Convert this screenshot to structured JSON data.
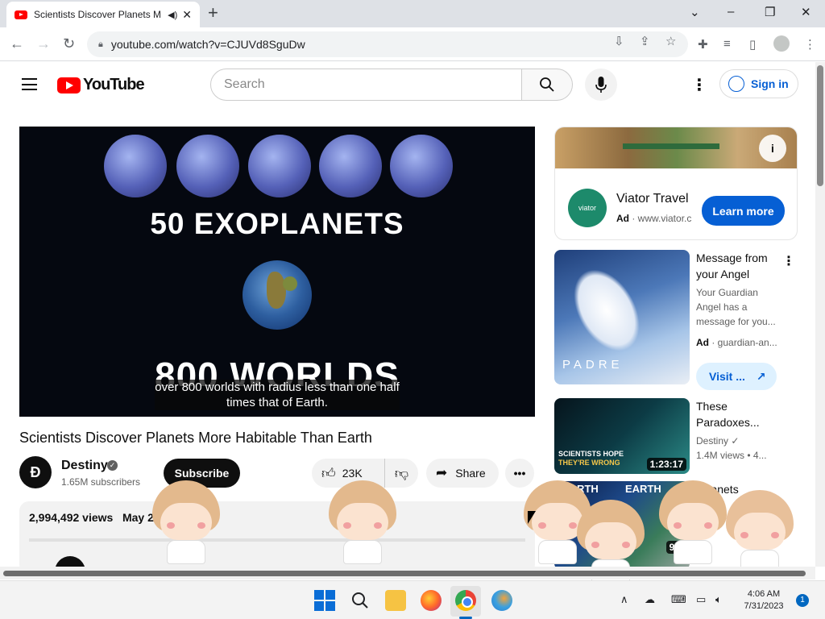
{
  "browser": {
    "tab_title": "Scientists Discover Planets M",
    "audio_icon": "speaker-icon",
    "url": "youtube.com/watch?v=CJUVd8SguDw",
    "new_tab": "+",
    "controls": {
      "dropdown": "⌄",
      "minimize": "–",
      "restore": "❐",
      "close": "✕"
    }
  },
  "youtube": {
    "logo_text": "YouTube",
    "search_placeholder": "Search",
    "sign_in": "Sign in"
  },
  "player": {
    "overlay_title_top": "50 EXOPLANETS",
    "overlay_title_bottom": "800 WORLDS",
    "caption": "over 800 worlds with radius less than one half times that of Earth."
  },
  "video": {
    "title": "Scientists Discover Planets More Habitable Than Earth",
    "channel": "Destiny",
    "subscribers": "1.65M subscribers",
    "subscribe_label": "Subscribe",
    "likes": "23K",
    "share_label": "Share",
    "views": "2,994,492 views",
    "date": "May 2"
  },
  "sidebar": {
    "ad": {
      "title": "Viator Travel",
      "badge": "Ad",
      "domain": "www.viator.c",
      "cta": "Learn more",
      "logo_text": "viator"
    },
    "recommendations": [
      {
        "title": "Message from your Angel",
        "desc": "Your Guardian Angel has a message for you...",
        "badge": "Ad",
        "domain": "guardian-an...",
        "cta": "Visit ...",
        "thumb_brand": "PADRE"
      },
      {
        "title": "These Paradoxes...",
        "channel": "Destiny",
        "meta": "1.4M views • 4...",
        "duration": "1:23:17",
        "thumb_text_1": "SCIENTISTS HOPE",
        "thumb_text_2": "THEY'RE WRONG"
      },
      {
        "title": "Planets",
        "thumb_text_1": "EARTH",
        "thumb_text_2": "EARTH",
        "duration": "9:5"
      }
    ]
  },
  "taskbar": {
    "time": "4:06 AM",
    "date": "7/31/2023",
    "notifications": "1"
  }
}
